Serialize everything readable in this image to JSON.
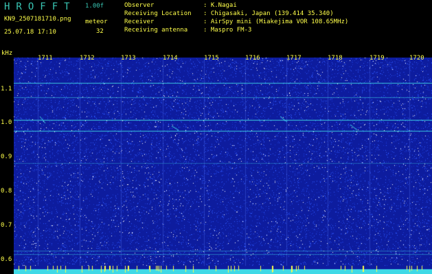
{
  "header": {
    "app_title": "HROFFT",
    "version": "1.00f",
    "filename": "KN9_2507181710.png",
    "datetime": "25.07.18 17:10",
    "meteor_label": "meteor",
    "meteor_count": "32"
  },
  "info": [
    {
      "key": "Observer",
      "value": ": K.Nagai"
    },
    {
      "key": "Receiving Location",
      "value": ": Chigasaki, Japan (139.414 35.340)"
    },
    {
      "key": "Receiver",
      "value": ": AirSpy mini (Miakejima VOR 108.65MHz)"
    },
    {
      "key": "Receiving antenna",
      "value": ": Maspro FM-3"
    }
  ],
  "spectrogram": {
    "freq_unit": "kHz",
    "freq_ticks": [
      "1.1",
      "1.0",
      "0.9",
      "0.8",
      "0.7",
      "0.6"
    ],
    "time_ticks": [
      "1711",
      "1712",
      "1713",
      "1714",
      "1715",
      "1716",
      "1717",
      "1718",
      "1719",
      "1720"
    ],
    "colors": {
      "background": "#0d1c9e",
      "noise": "#2d57ff",
      "bright": "#ffffff",
      "signal": "#3fd9e6",
      "label": "#ffff4a",
      "title": "#39c6b4"
    }
  }
}
